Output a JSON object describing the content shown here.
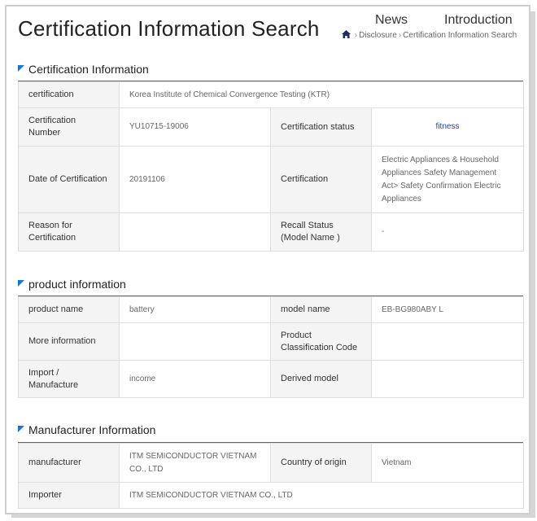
{
  "header": {
    "title": "Certification Information Search",
    "nav": [
      {
        "label": "News"
      },
      {
        "label": "Introduction"
      }
    ],
    "breadcrumb": [
      "Disclosure",
      "Certification Information Search"
    ]
  },
  "sections": {
    "certification": {
      "title": "Certification Information",
      "rows": {
        "certification_label": "certification",
        "certification_value": "Korea Institute of Chemical Convergence Testing (KTR)",
        "number_label": "Certification Number",
        "number_value": "YU10715-19006",
        "status_label": "Certification status",
        "status_value": "fitness",
        "date_label": "Date of Certification",
        "date_value": "20191106",
        "cert_label": "Certification",
        "cert_value": "Electric Appliances & Household Appliances Safety Management Act> Safety Confirmation Electric Appliances",
        "reason_label": "Reason for Certification",
        "reason_value": "",
        "recall_label": "Recall Status (Model Name )",
        "recall_value": "-"
      }
    },
    "product": {
      "title": "product information",
      "rows": {
        "name_label": "product name",
        "name_value": "battery",
        "model_label": "model name",
        "model_value": "EB-BG980ABY L",
        "more_label": "More information",
        "more_value": "",
        "class_label": "Product Classification Code",
        "class_value": "",
        "import_label": "Import / Manufacture",
        "import_value": "income",
        "derived_label": "Derived model",
        "derived_value": ""
      }
    },
    "manufacturer": {
      "title": "Manufacturer Information",
      "rows": {
        "mfr_label": "manufacturer",
        "mfr_value": "ITM SEMICONDUCTOR VIETNAM CO., LTD",
        "origin_label": "Country of origin",
        "origin_value": "Vietnam",
        "importer_label": "Importer",
        "importer_value": "ITM SEMICONDUCTOR VIETNAM CO., LTD"
      }
    }
  },
  "colors": {
    "accent": "#1a73d9",
    "status": "#1f3fb8",
    "label_bg": "#f4f4f4",
    "border": "#dddddd"
  }
}
